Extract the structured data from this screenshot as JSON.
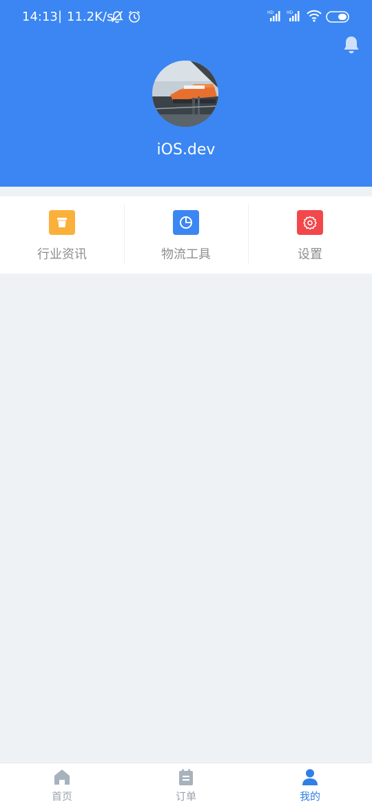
{
  "status_bar": {
    "time": "14:13",
    "separator": "|",
    "network_speed": "11.2K/s"
  },
  "profile": {
    "username": "iOS.dev"
  },
  "menu": {
    "items": [
      {
        "label": "行业资讯",
        "icon": "news-icon",
        "color": "#fbb03b"
      },
      {
        "label": "物流工具",
        "icon": "pie-chart-icon",
        "color": "#3b86f2"
      },
      {
        "label": "设置",
        "icon": "gear-icon",
        "color": "#f2484b"
      }
    ]
  },
  "tabbar": {
    "tabs": [
      {
        "label": "首页",
        "icon": "home-icon",
        "active": false
      },
      {
        "label": "订单",
        "icon": "order-icon",
        "active": false
      },
      {
        "label": "我的",
        "icon": "user-icon",
        "active": true
      }
    ]
  },
  "colors": {
    "primary": "#3b86f2",
    "background": "#eff2f5",
    "tab_active": "#2f7fe6",
    "tab_inactive": "#9aa3ad"
  }
}
